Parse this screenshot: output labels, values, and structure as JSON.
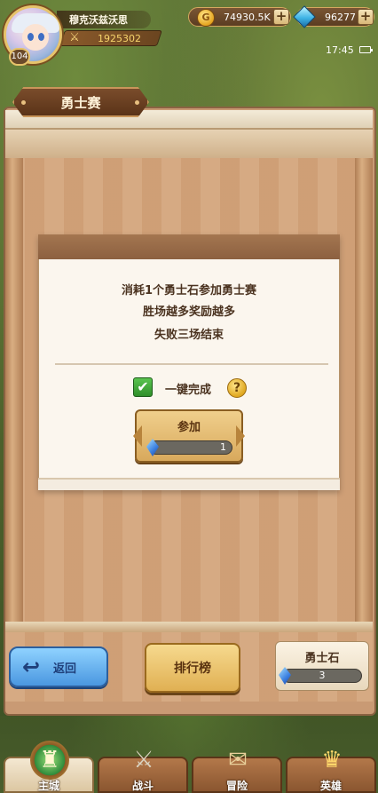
{
  "player": {
    "name": "穆克沃兹沃思",
    "level": "104",
    "power": "1925302"
  },
  "resources": {
    "gold": "74930.5K",
    "gems": "96277"
  },
  "status": {
    "time": "17:45"
  },
  "page": {
    "title": "勇士赛"
  },
  "dialog": {
    "line1": "消耗1个勇士石参加勇士赛",
    "line2": "胜场越多奖励越多",
    "line3": "失败三场结束",
    "auto_complete_label": "一键完成",
    "auto_complete_checked": true,
    "join_label": "参加",
    "join_cost": "1"
  },
  "actions": {
    "back_label": "返回",
    "ranking_label": "排行榜"
  },
  "warrior_stone": {
    "label": "勇士石",
    "count": "3"
  },
  "nav": {
    "tabs": [
      {
        "label": "主城",
        "icon": "castle-icon",
        "active": true
      },
      {
        "label": "战斗",
        "icon": "crossed-swords-icon",
        "active": false
      },
      {
        "label": "冒险",
        "icon": "scroll-map-icon",
        "active": false
      },
      {
        "label": "英雄",
        "icon": "hero-crest-icon",
        "active": false
      }
    ]
  },
  "colors": {
    "panel": "#c99a74",
    "dialog": "#fbf6ee",
    "back_button": "#4a97e0",
    "ranking_button": "#e0b053",
    "checkbox": "#2f8f2a"
  }
}
